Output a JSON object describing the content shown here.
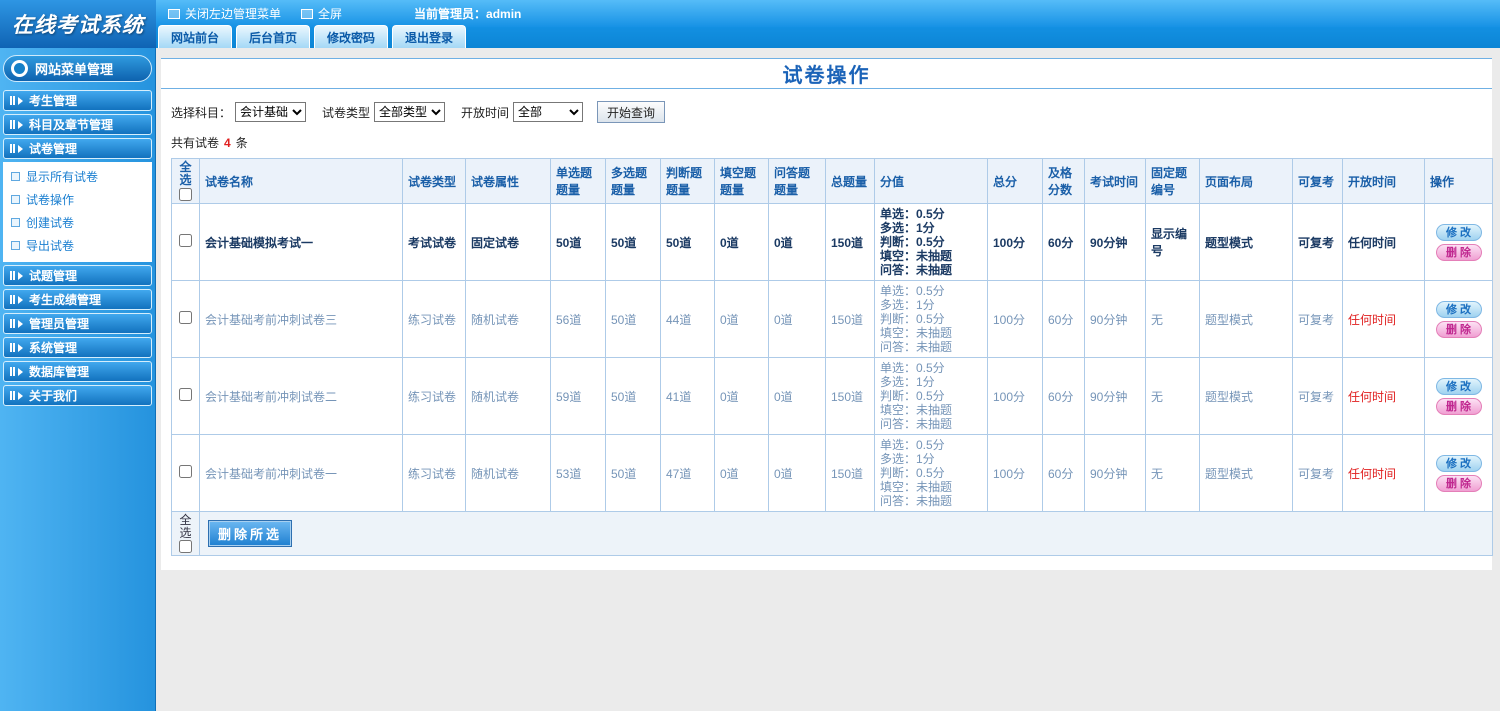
{
  "topbar": {
    "logo": "在线考试系统",
    "close_menu": "关闭左边管理菜单",
    "fullscreen": "全屏",
    "admin": "当前管理员：admin",
    "tabs": [
      "网站前台",
      "后台首页",
      "修改密码",
      "退出登录"
    ]
  },
  "sidebar": {
    "header": "网站菜单管理",
    "items": [
      {
        "label": "考生管理"
      },
      {
        "label": "科目及章节管理"
      },
      {
        "label": "试卷管理",
        "children": [
          "显示所有试卷",
          "试卷操作",
          "创建试卷",
          "导出试卷"
        ]
      },
      {
        "label": "试题管理"
      },
      {
        "label": "考生成绩管理"
      },
      {
        "label": "管理员管理"
      },
      {
        "label": "系统管理"
      },
      {
        "label": "数据库管理"
      },
      {
        "label": "关于我们"
      }
    ]
  },
  "main": {
    "title": "试卷操作",
    "filters": {
      "subject_label": "选择科目：",
      "subject_value": "会计基础",
      "type_label": "试卷类型",
      "type_value": "全部类型",
      "time_label": "开放时间",
      "time_value": "全部",
      "query_button": "开始查询"
    },
    "count_prefix": "共有试卷",
    "count_value": "4",
    "count_suffix": "条",
    "table": {
      "headers": [
        "全选",
        "试卷名称",
        "试卷类型",
        "试卷属性",
        "单选题题量",
        "多选题题量",
        "判断题题量",
        "填空题题量",
        "问答题题量",
        "总题量",
        "分值",
        "总分",
        "及格分数",
        "考试时间",
        "固定题编号",
        "页面布局",
        "可复考",
        "开放时间",
        "操作"
      ],
      "action_edit": "修改",
      "action_delete": "删除",
      "rows": [
        {
          "bold": true,
          "name": "会计基础模拟考试一",
          "type": "考试试卷",
          "attr": "固定试卷",
          "single": "50道",
          "multi": "50道",
          "judge": "50道",
          "blank": "0道",
          "qa": "0道",
          "total": "150道",
          "scores": [
            "单选：0.5分",
            "多选：1分",
            "判断：0.5分",
            "填空：未抽题",
            "问答：未抽题"
          ],
          "total_score": "100分",
          "pass_score": "60分",
          "duration": "90分钟",
          "fixed_no": "显示编号",
          "layout": "题型模式",
          "retake": "可复考",
          "open_time": "任何时间"
        },
        {
          "bold": false,
          "name": "会计基础考前冲刺试卷三",
          "type": "练习试卷",
          "attr": "随机试卷",
          "single": "56道",
          "multi": "50道",
          "judge": "44道",
          "blank": "0道",
          "qa": "0道",
          "total": "150道",
          "scores": [
            "单选：0.5分",
            "多选：1分",
            "判断：0.5分",
            "填空：未抽题",
            "问答：未抽题"
          ],
          "total_score": "100分",
          "pass_score": "60分",
          "duration": "90分钟",
          "fixed_no": "无",
          "layout": "题型模式",
          "retake": "可复考",
          "open_time": "任何时间"
        },
        {
          "bold": false,
          "name": "会计基础考前冲刺试卷二",
          "type": "练习试卷",
          "attr": "随机试卷",
          "single": "59道",
          "multi": "50道",
          "judge": "41道",
          "blank": "0道",
          "qa": "0道",
          "total": "150道",
          "scores": [
            "单选：0.5分",
            "多选：1分",
            "判断：0.5分",
            "填空：未抽题",
            "问答：未抽题"
          ],
          "total_score": "100分",
          "pass_score": "60分",
          "duration": "90分钟",
          "fixed_no": "无",
          "layout": "题型模式",
          "retake": "可复考",
          "open_time": "任何时间"
        },
        {
          "bold": false,
          "name": "会计基础考前冲刺试卷一",
          "type": "练习试卷",
          "attr": "随机试卷",
          "single": "53道",
          "multi": "50道",
          "judge": "47道",
          "blank": "0道",
          "qa": "0道",
          "total": "150道",
          "scores": [
            "单选：0.5分",
            "多选：1分",
            "判断：0.5分",
            "填空：未抽题",
            "问答：未抽题"
          ],
          "total_score": "100分",
          "pass_score": "60分",
          "duration": "90分钟",
          "fixed_no": "无",
          "layout": "题型模式",
          "retake": "可复考",
          "open_time": "任何时间"
        }
      ]
    },
    "footer": {
      "select_all": "全选",
      "delete_selected": "删除所选"
    }
  }
}
